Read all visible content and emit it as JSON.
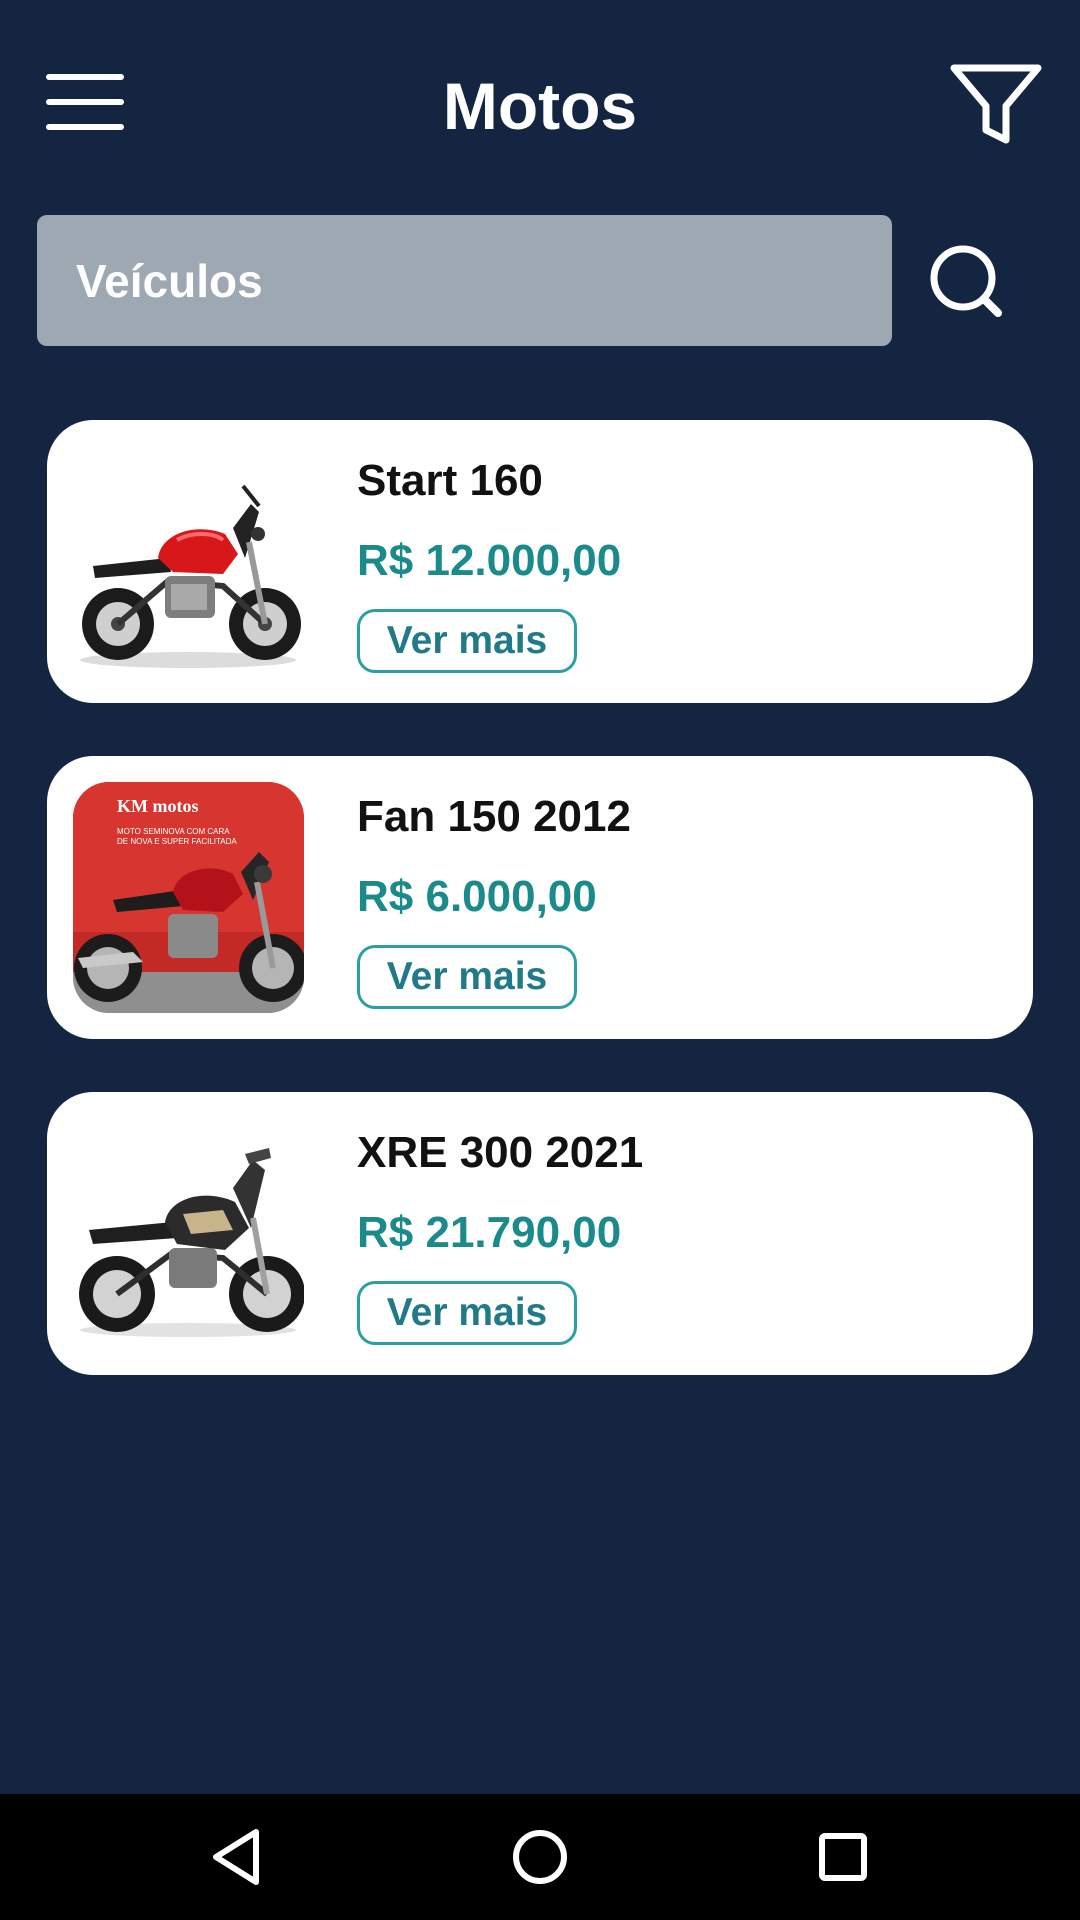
{
  "header": {
    "title": "Motos",
    "menu_icon": "hamburger-menu-icon",
    "filter_icon": "filter-funnel-icon"
  },
  "search": {
    "placeholder": "Veículos",
    "value": "",
    "icon": "search-icon"
  },
  "vehicles": [
    {
      "name": "Start 160",
      "price": "R$ 12.000,00",
      "button_label": "Ver mais",
      "photo": "red-black-street-motorcycle-photo"
    },
    {
      "name": "Fan 150 2012",
      "price": "R$ 6.000,00",
      "button_label": "Ver mais",
      "photo": "red-motorcycle-in-dealer-photo",
      "photo_banner_text": [
        "KM motos",
        "MOTO SEMINOVA COM CARA",
        "DE NOVA E SUPER FACILITADA"
      ]
    },
    {
      "name": "XRE 300 2021",
      "price": "R$ 21.790,00",
      "button_label": "Ver mais",
      "photo": "black-gold-trail-motorcycle-photo"
    }
  ],
  "nav": {
    "back_icon": "back-triangle-icon",
    "home_icon": "home-circle-icon",
    "recents_icon": "recents-square-icon"
  },
  "colors": {
    "background": "#132540",
    "search_field": "#9ea8b3",
    "card": "#ffffff",
    "price": "#1b8a8a",
    "button_border": "#2aa0a6",
    "nav_bar": "#000000"
  }
}
